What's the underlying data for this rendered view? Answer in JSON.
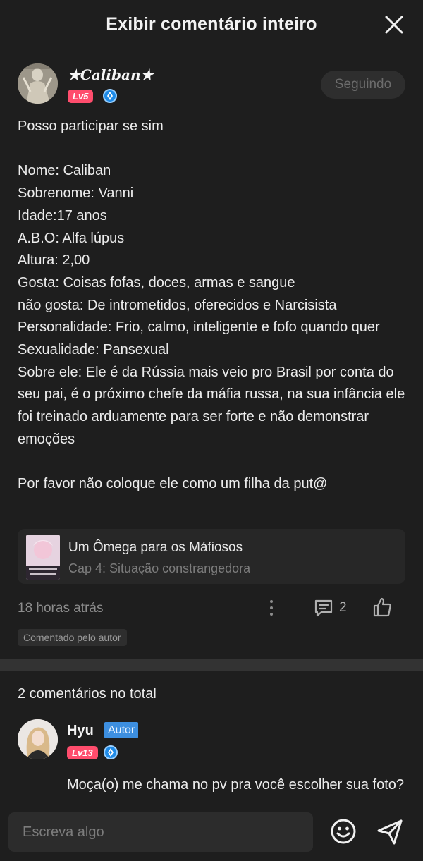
{
  "header": {
    "title": "Exibir comentário inteiro",
    "close_icon": "close-icon"
  },
  "comment": {
    "author": "★Caliban★",
    "level": "Lv5",
    "subscriber_icon": "subscriber-badge-icon",
    "follow_label": "Seguindo",
    "text": "Posso participar se sim\n\nNome: Caliban\nSobrenome: Vanni\nIdade:17 anos\nA.B.O: Alfa lúpus\nAltura: 2,00\nGosta: Coisas fofas, doces, armas e sangue\nnão gosta: De intrometidos, oferecidos e Narcisista\nPersonalidade: Frio, calmo, inteligente e fofo quando quer\nSexualidade: Pansexual\nSobre ele: Ele é da Rússia mais veio pro Brasil por conta do seu pai, é o próximo chefe da máfia russa, na sua infância ele foi treinado arduamente para ser forte e não demonstrar emoções\n\nPor favor não coloque ele como um filha da put@",
    "book": {
      "title": "Um Ômega para os Máfiosos",
      "chapter": "Cap 4: Situação constrangedora"
    },
    "time": "18 horas atrás",
    "reply_count": "2",
    "tag": "Comentado pelo autor"
  },
  "replies": {
    "total_label": "2 comentários no total",
    "items": [
      {
        "name": "Hyu",
        "badge": "Autor",
        "level": "Lv13",
        "text": "Moça(o) me chama no pv pra você escolher sua foto?"
      }
    ]
  },
  "footer": {
    "input_placeholder": "Escreva algo",
    "emoji_icon": "emoji-icon",
    "send_icon": "send-icon"
  },
  "colors": {
    "background": "#1e1e1e",
    "level_badge": "#ff4d6d",
    "author_badge": "#3d8fe0",
    "card": "#272727"
  }
}
